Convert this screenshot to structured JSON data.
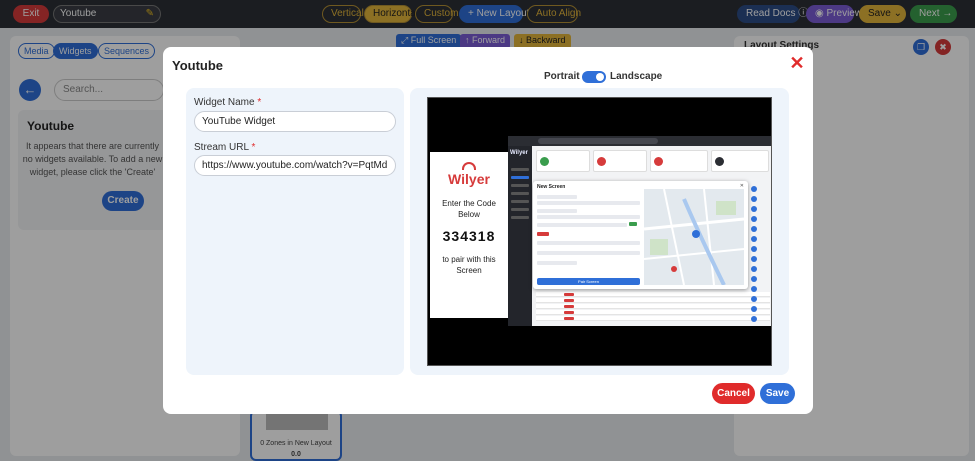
{
  "toolbar": {
    "exit_label": "Exit",
    "layout_name": "Youtube",
    "orientation_options": [
      "Vertical",
      "Horizontal",
      "Custom"
    ],
    "active_orientation": "Horizontal",
    "new_layout_label": "+ New Layout",
    "auto_align_label": "Auto Align",
    "read_docs_label": "Read Docs",
    "read_docs_icon": "info-icon",
    "preview_label": "Preview",
    "preview_icon": "eye-icon",
    "save_label": "Save",
    "save_icon": "chevron-down-icon",
    "next_label": "Next →"
  },
  "sidebar": {
    "tabs": [
      "Media",
      "Widgets",
      "Sequences"
    ],
    "active_tab": "Widgets",
    "search_placeholder": "Search...",
    "card_title": "Youtube",
    "card_text": "It appears that there are currently no widgets available. To add a new widget, please click the 'Create'",
    "create_label": "Create"
  },
  "canvas": {
    "full_screen_label": "Full Screen",
    "forward_label": "Forward",
    "backward_label": "Backward",
    "zone_caption": "0 Zones in New Layout",
    "zone_value": "0.0"
  },
  "right_panel": {
    "title": "Layout Settings"
  },
  "modal": {
    "title": "Youtube",
    "close_icon": "close-icon",
    "orientation_left": "Portrait",
    "orientation_right": "Landscape",
    "widget_name_label": "Widget Name",
    "widget_name_value": "YouTube Widget",
    "stream_url_label": "Stream URL",
    "stream_url_value": "https://www.youtube.com/watch?v=PqtMdFkN",
    "required_mark": "*",
    "cancel_label": "Cancel",
    "save_label": "Save"
  },
  "preview_video": {
    "brand": "Wilyer",
    "enter_text": "Enter the Code Below",
    "pair_code": "334318",
    "pair_text": "to pair with this Screen",
    "dialog_title": "New Screen",
    "pair_button": "Pair Screen"
  },
  "colors": {
    "primary": "#2f6fd8",
    "danger": "#e02b2b",
    "accent": "#e3b53a",
    "success": "#3a9d4d"
  }
}
